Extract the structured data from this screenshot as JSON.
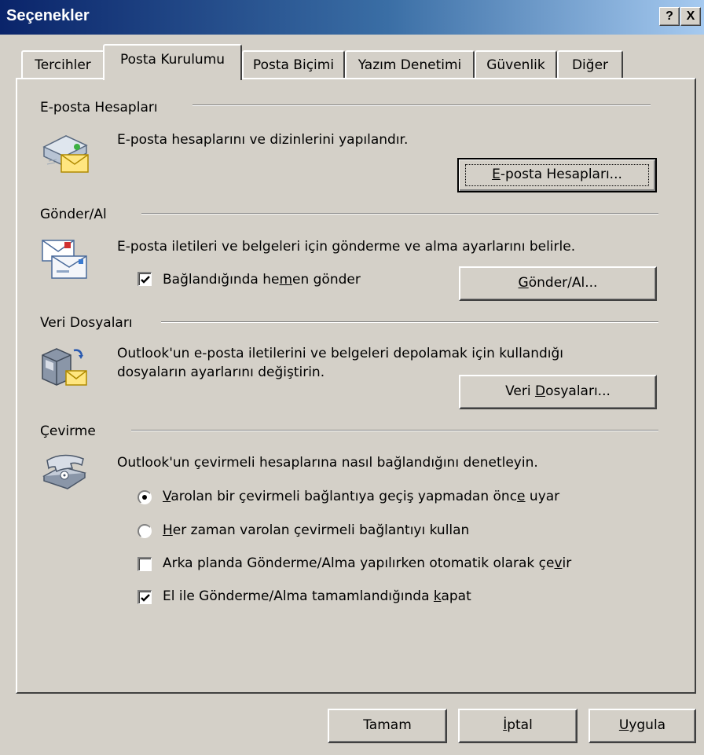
{
  "window": {
    "title": "Seçenekler",
    "help_glyph": "?",
    "close_glyph": "X"
  },
  "tabs": [
    {
      "label": "Tercihler",
      "active": false
    },
    {
      "label": "Posta Kurulumu",
      "active": true
    },
    {
      "label": "Posta Biçimi",
      "active": false
    },
    {
      "label": "Yazım Denetimi",
      "active": false
    },
    {
      "label": "Güvenlik",
      "active": false
    },
    {
      "label": "Diğer",
      "active": false
    }
  ],
  "email_accounts": {
    "heading": "E-posta Hesapları",
    "description": "E-posta hesaplarını ve dizinlerini yapılandır.",
    "button": {
      "mnemonic": "E",
      "rest": "-posta Hesapları..."
    },
    "icon": "email-accounts-icon"
  },
  "send_receive": {
    "heading": "Gönder/Al",
    "description": "E-posta iletileri ve belgeleri için gönderme ve alma ayarlarını belirle.",
    "checkbox": {
      "pre": "Bağlandığında he",
      "mnemonic": "m",
      "post": "en gönder",
      "checked": true
    },
    "button": {
      "mnemonic": "G",
      "rest": "önder/Al..."
    },
    "icon": "send-receive-icon"
  },
  "data_files": {
    "heading": "Veri Dosyaları",
    "description_line1": "Outlook'un e-posta iletilerini ve belgeleri depolamak için kullandığı",
    "description_line2": "dosyaların ayarlarını değiştirin.",
    "button": {
      "pre": "Veri ",
      "mnemonic": "D",
      "post": "osyaları..."
    },
    "icon": "data-files-icon"
  },
  "dialup": {
    "heading": "Çevirme",
    "description": "Outlook'un çevirmeli hesaplarına nasıl bağlandığını denetleyin.",
    "icon": "telephone-icon",
    "radio1": {
      "mnemonic": "V",
      "rest": "arolan bir çevirmeli bağlantıya geçiş yapmadan önc",
      "mnemonic2": "e",
      "post": " uyar",
      "selected": true
    },
    "radio2": {
      "mnemonic": "H",
      "rest": "er zaman varolan çevirmeli bağlantıyı kullan",
      "selected": false
    },
    "checkbox1": {
      "pre": "Arka planda Gönderme/Alma yapılırken otomatik olarak çe",
      "mnemonic": "v",
      "post": "ir",
      "checked": false
    },
    "checkbox2": {
      "pre": "El ile Gönderme/Alma tamamlandığında ",
      "mnemonic": "k",
      "post": "apat",
      "checked": true
    }
  },
  "footer": {
    "ok_label": "Tamam",
    "cancel": {
      "mnemonic": "İ",
      "rest": "ptal"
    },
    "apply": {
      "mnemonic": "U",
      "rest": "ygula"
    }
  }
}
